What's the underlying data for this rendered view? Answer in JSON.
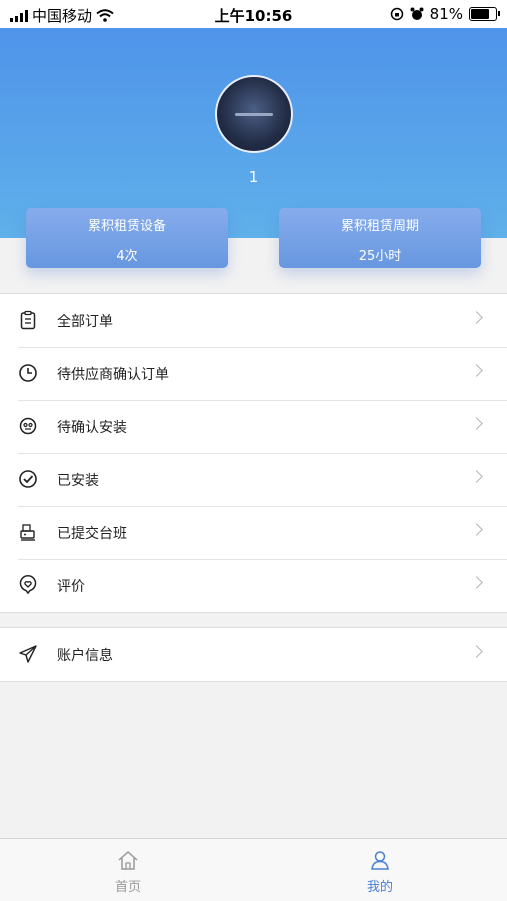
{
  "status_bar": {
    "carrier": "中国移动",
    "time": "上午10:56",
    "battery": "81%",
    "battery_level": 0.81
  },
  "profile": {
    "username": "1"
  },
  "stats": [
    {
      "label": "累积租赁设备",
      "value": "4次"
    },
    {
      "label": "累积租赁周期",
      "value": "25小时"
    }
  ],
  "menu": {
    "items": [
      {
        "label": "全部订单",
        "icon": "clipboard-icon"
      },
      {
        "label": "待供应商确认订单",
        "icon": "clock-icon"
      },
      {
        "label": "待确认安装",
        "icon": "face-icon"
      },
      {
        "label": "已安装",
        "icon": "check-circle-icon"
      },
      {
        "label": "已提交台班",
        "icon": "machine-icon"
      },
      {
        "label": "评价",
        "icon": "heart-chat-icon"
      }
    ]
  },
  "account": {
    "label": "账户信息",
    "icon": "paper-plane-icon"
  },
  "tabbar": {
    "home": {
      "label": "首页",
      "icon": "home-icon",
      "color": "#999999"
    },
    "mine": {
      "label": "我的",
      "icon": "user-icon",
      "color": "#4a7fd6"
    }
  }
}
